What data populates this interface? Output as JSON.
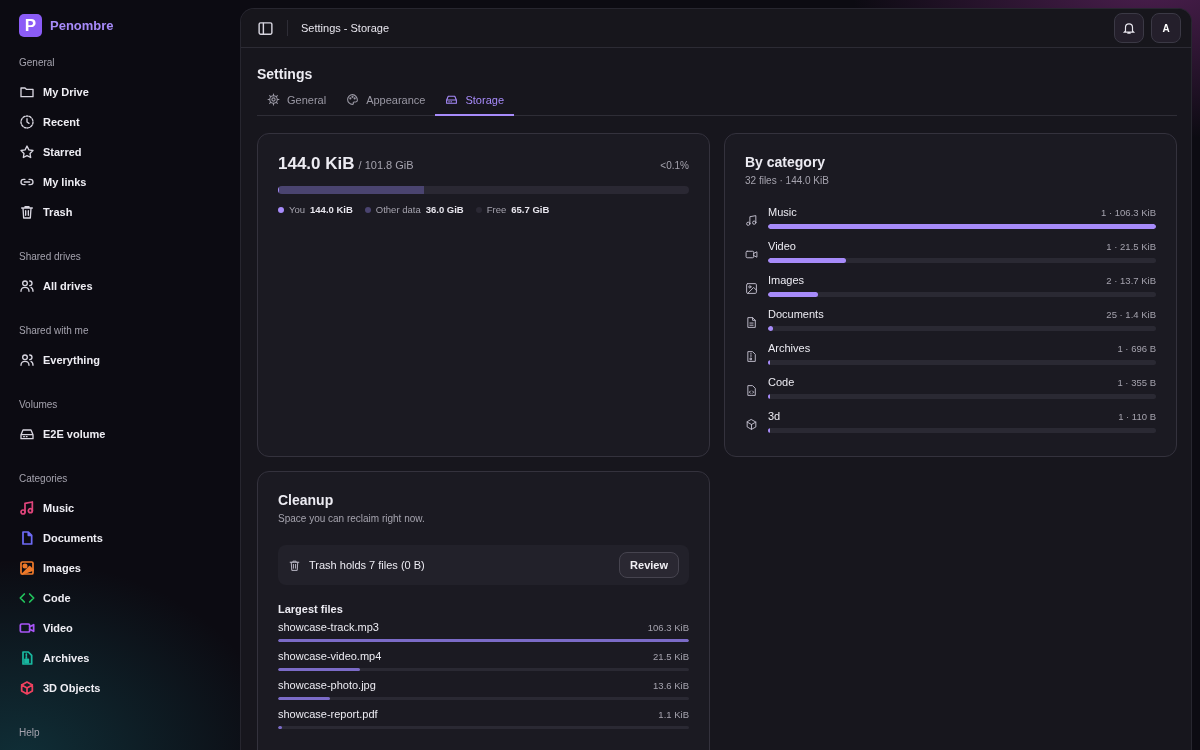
{
  "app": {
    "logo_letter": "P",
    "name": "Penombre"
  },
  "sidebar": {
    "sections": [
      {
        "title": "General",
        "items": [
          {
            "label": "My Drive"
          },
          {
            "label": "Recent"
          },
          {
            "label": "Starred"
          },
          {
            "label": "My links"
          },
          {
            "label": "Trash"
          }
        ]
      },
      {
        "title": "Shared drives",
        "items": [
          {
            "label": "All drives"
          }
        ]
      },
      {
        "title": "Shared with me",
        "items": [
          {
            "label": "Everything"
          }
        ]
      },
      {
        "title": "Volumes",
        "items": [
          {
            "label": "E2E volume"
          }
        ]
      },
      {
        "title": "Categories",
        "items": [
          {
            "label": "Music",
            "color": "#e0457b"
          },
          {
            "label": "Documents",
            "color": "#6d6af5"
          },
          {
            "label": "Images",
            "color": "#f07a2a"
          },
          {
            "label": "Code",
            "color": "#22c55e"
          },
          {
            "label": "Video",
            "color": "#a855f7"
          },
          {
            "label": "Archives",
            "color": "#19b8a0"
          },
          {
            "label": "3D Objects",
            "color": "#f0415f"
          }
        ]
      },
      {
        "title": "Help"
      }
    ]
  },
  "topbar": {
    "title": "Settings - Storage",
    "avatar": "A"
  },
  "page_title": "Settings",
  "tabs": [
    {
      "label": "General",
      "selected": false
    },
    {
      "label": "Appearance",
      "selected": false
    },
    {
      "label": "Storage",
      "selected": true
    }
  ],
  "usage": {
    "used": "144.0 KiB",
    "total": "/ 101.8 GiB",
    "percent": "<0.1%",
    "segments": [
      {
        "label": "You",
        "value": "144.0 KiB",
        "color": "#a78bfa",
        "level": 0.002
      },
      {
        "label": "Other data",
        "value": "36.0 GiB",
        "color": "#4a4470",
        "level": 0.354
      },
      {
        "label": "Free",
        "value": "65.7 GiB",
        "color": "#2a2833"
      }
    ]
  },
  "by_category": {
    "title": "By category",
    "subtitle": "32 files · 144.0 KiB",
    "rows": [
      {
        "name": "Music",
        "reading": "1 · 106.3 KiB",
        "level": 1.0
      },
      {
        "name": "Video",
        "reading": "1 · 21.5 KiB",
        "level": 0.2
      },
      {
        "name": "Images",
        "reading": "2 · 13.7 KiB",
        "level": 0.13
      },
      {
        "name": "Documents",
        "reading": "25 · 1.4 KiB",
        "level": 0.012
      },
      {
        "name": "Archives",
        "reading": "1 · 696 B",
        "level": 0.006
      },
      {
        "name": "Code",
        "reading": "1 · 355 B",
        "level": 0.003
      },
      {
        "name": "3d",
        "reading": "1 · 110 B",
        "level": 0.001
      }
    ]
  },
  "cleanup": {
    "title": "Cleanup",
    "subtitle": "Space you can reclaim right now.",
    "trash_text": "Trash holds 7 files (0 B)",
    "review_button": "Review",
    "largest_title": "Largest files",
    "files": [
      {
        "name": "showcase-track.mp3",
        "size": "106.3 KiB",
        "level": 1.0
      },
      {
        "name": "showcase-video.mp4",
        "size": "21.5 KiB",
        "level": 0.2
      },
      {
        "name": "showcase-photo.jpg",
        "size": "13.6 KiB",
        "level": 0.127
      },
      {
        "name": "showcase-report.pdf",
        "size": "1.1 KiB",
        "level": 0.01
      }
    ]
  }
}
